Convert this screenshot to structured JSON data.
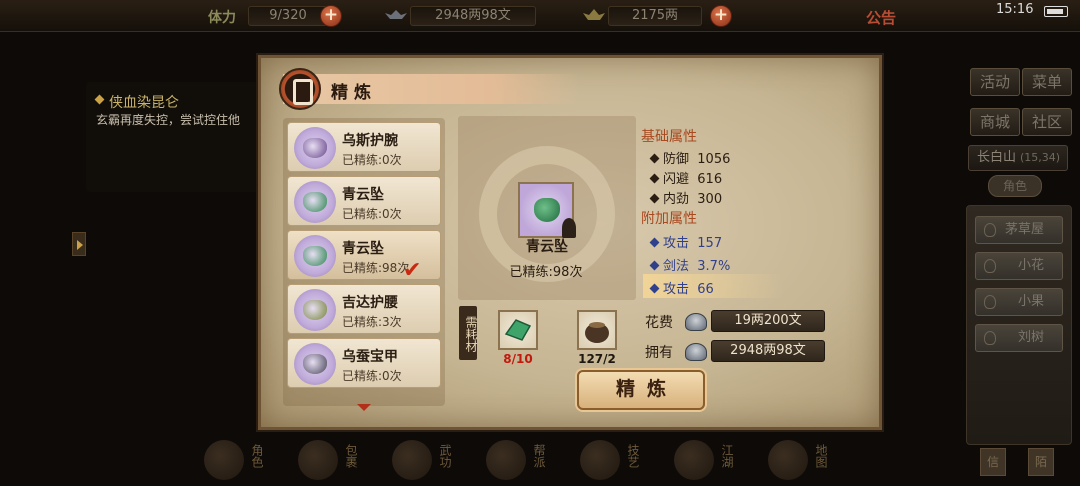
{
  "topbar": {
    "stamina_label": "体力",
    "stamina_value": "9/320",
    "silver_value": "2948两98文",
    "gold_value": "2175两",
    "announcement": "公告",
    "time": "15:16"
  },
  "quest": {
    "title": "侠血染昆仑",
    "description": "玄霸再度失控，尝试控住他"
  },
  "right_menu": {
    "buttons": [
      "活动",
      "菜单",
      "商城",
      "社区"
    ],
    "location": "长白山",
    "coords": "(15,34)",
    "role_tab": "角色",
    "npcs": [
      "茅草屋",
      "小花",
      "小果",
      "刘树"
    ]
  },
  "bottom_nav": {
    "items": [
      "角色",
      "包裹",
      "武功",
      "帮派",
      "技艺",
      "江湖",
      "地图"
    ],
    "corner": [
      "信",
      "陌"
    ]
  },
  "dialog": {
    "title": "精炼",
    "items": [
      {
        "name": "乌斯护腕",
        "count": "已精练:0次",
        "gem_color": "#6b4a8c"
      },
      {
        "name": "青云坠",
        "count": "已精练:0次",
        "gem_color": "#2f8a52"
      },
      {
        "name": "青云坠",
        "count": "已精练:98次",
        "gem_color": "#2f8a52"
      },
      {
        "name": "吉达护腰",
        "count": "已精练:3次",
        "gem_color": "#7a8a3a"
      },
      {
        "name": "乌蚕宝甲",
        "count": "已精练:0次",
        "gem_color": "#4a4a5a"
      }
    ],
    "preview": {
      "name": "青云坠",
      "count": "已精练:98次"
    },
    "base_stats_label": "基础属性",
    "base_stats": [
      {
        "name": "防御",
        "value": "1056"
      },
      {
        "name": "闪避",
        "value": "616"
      },
      {
        "name": "内劲",
        "value": "300"
      }
    ],
    "extra_stats_label": "附加属性",
    "extra_stats": [
      {
        "name": "攻击",
        "value": "157"
      },
      {
        "name": "剑法",
        "value": "3.7%"
      },
      {
        "name": "攻击",
        "value": "66"
      }
    ],
    "materials_label": "需耗材",
    "materials": [
      {
        "count": "8/10",
        "color": "#c2190e"
      },
      {
        "count": "127/2",
        "color": "#1e1810"
      }
    ],
    "cost_label": "花费",
    "cost_value": "19两200文",
    "own_label": "拥有",
    "own_value": "2948两98文",
    "refine_button": "精炼"
  }
}
